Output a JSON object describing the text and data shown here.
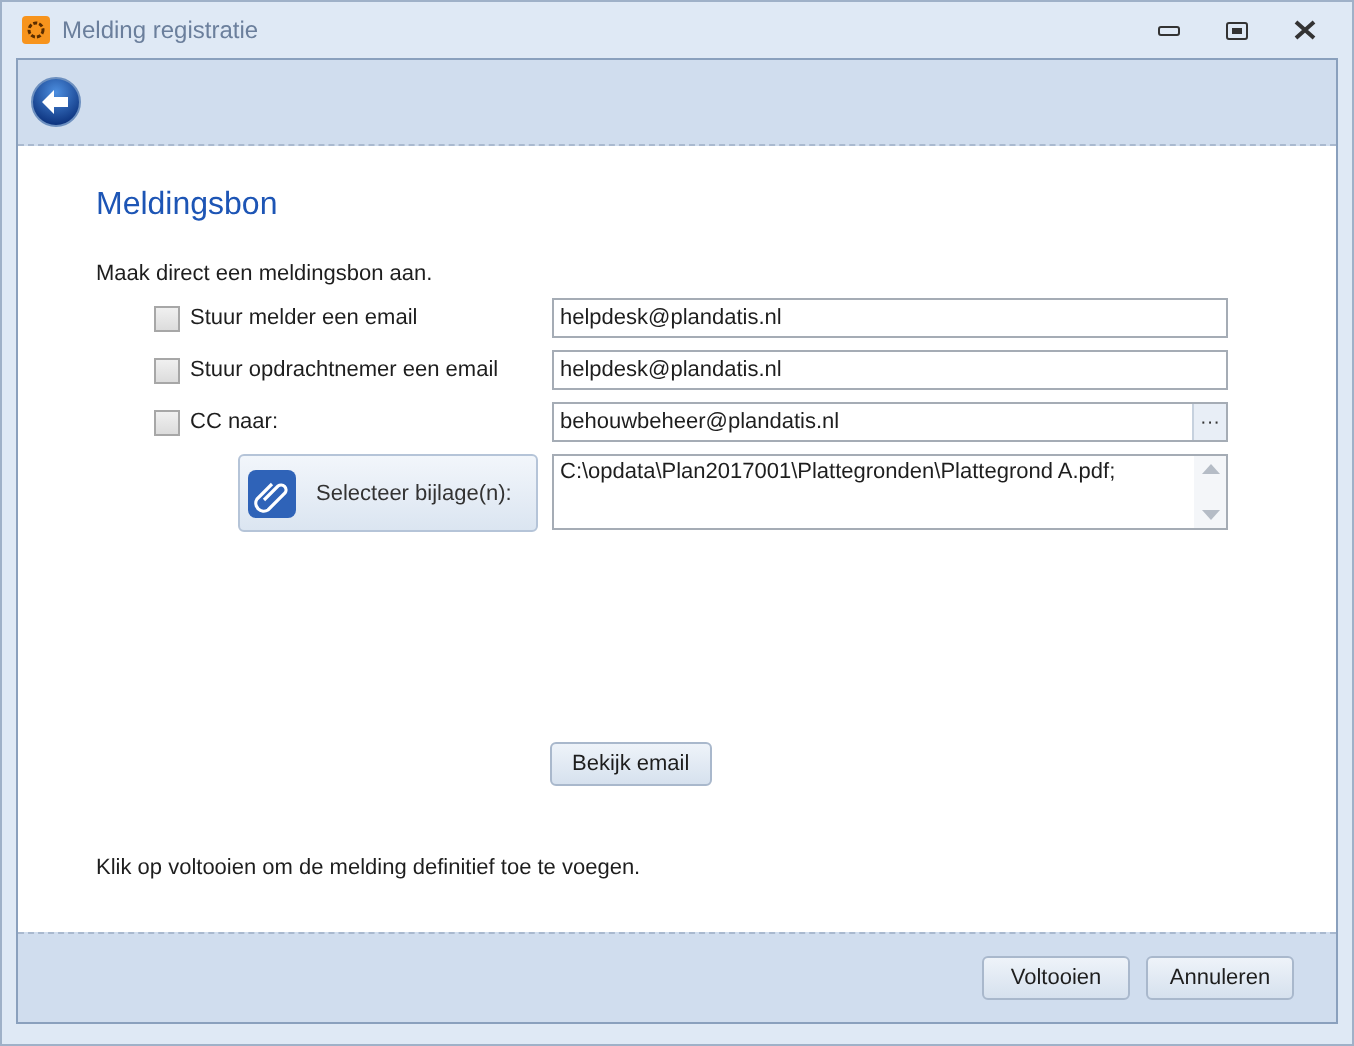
{
  "window": {
    "title": "Melding registratie"
  },
  "heading": "Meldingsbon",
  "intro": "Maak direct een meldingsbon aan.",
  "recipients": [
    {
      "label": "Stuur melder een email",
      "checked": false,
      "value": "helpdesk@plandatis.nl",
      "browse": false
    },
    {
      "label": "Stuur opdrachtnemer een email",
      "checked": false,
      "value": "helpdesk@plandatis.nl",
      "browse": false
    },
    {
      "label": "CC naar:",
      "checked": false,
      "value": "behouwbeheer@plandatis.nl",
      "browse": true
    }
  ],
  "browse_label": "···",
  "attachment": {
    "button": "Selecteer bijlage(n):",
    "value": "C:\\opdata\\Plan2017001\\Plattegronden\\Plattegrond A.pdf;"
  },
  "preview_button": "Bekijk email",
  "footer_note": "Klik op voltooien om de melding definitief toe te voegen.",
  "buttons": [
    "Voltooien",
    "Annuleren"
  ]
}
